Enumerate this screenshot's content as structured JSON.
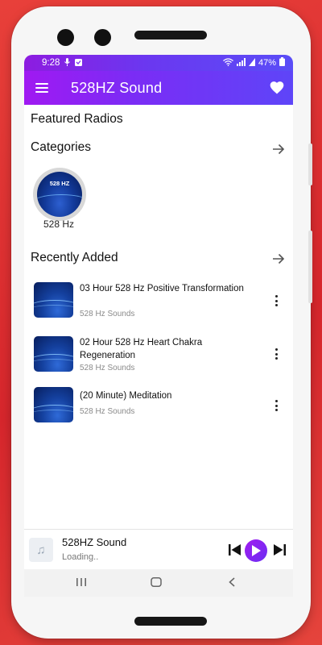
{
  "status_bar": {
    "time": "9:28",
    "mic_icon": "mic-icon",
    "notification_icon": "notification-icon",
    "battery": "47%"
  },
  "app_bar": {
    "title": "528HZ Sound",
    "menu_icon": "hamburger-icon",
    "favorite_icon": "heart-icon"
  },
  "sections": {
    "featured": "Featured Radios",
    "categories": "Categories",
    "recent": "Recently Added"
  },
  "categories": [
    {
      "thumb_label": "528 HZ",
      "name": "528 Hz"
    }
  ],
  "recent": [
    {
      "title": "03 Hour 528 Hz Positive Transformation",
      "subtitle": "528 Hz Sounds"
    },
    {
      "title": "02 Hour 528 Hz Heart Chakra Regeneration",
      "subtitle": "528 Hz Sounds"
    },
    {
      "title": "(20 Minute) Meditation",
      "subtitle": "528 Hz Sounds"
    }
  ],
  "player": {
    "title": "528HZ Sound",
    "status": "Loading.."
  },
  "colors": {
    "accent_start": "#a019f2",
    "accent_end": "#5e45f8",
    "background": "#e23b36"
  }
}
